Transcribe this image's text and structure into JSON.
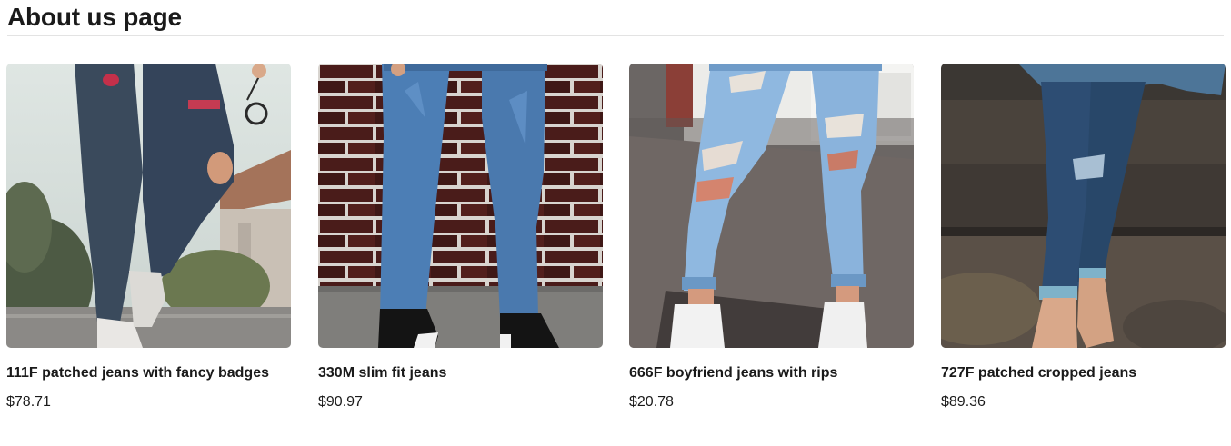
{
  "page": {
    "title": "About us page"
  },
  "products": [
    {
      "name": "111F patched jeans with fancy badges",
      "price": "$78.71",
      "image_label": "patched-jeans-photo"
    },
    {
      "name": "330M slim fit jeans",
      "price": "$90.97",
      "image_label": "slim-fit-jeans-photo"
    },
    {
      "name": "666F boyfriend jeans with rips",
      "price": "$20.78",
      "image_label": "boyfriend-jeans-photo"
    },
    {
      "name": "727F patched cropped jeans",
      "price": "$89.36",
      "image_label": "cropped-jeans-photo"
    }
  ]
}
